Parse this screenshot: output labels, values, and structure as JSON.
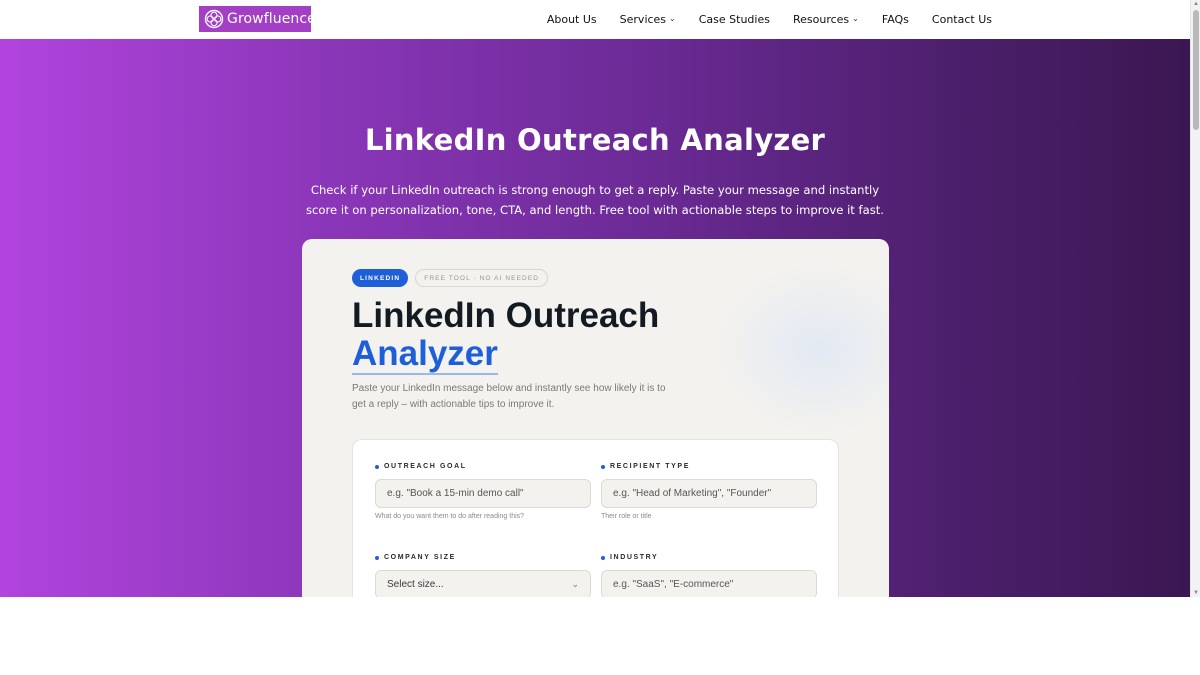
{
  "brand": {
    "name": "Growfluence",
    "logo_icon": "flower-icon",
    "color": "#a33fc4"
  },
  "nav": {
    "items": [
      {
        "label": "About Us",
        "dropdown": false
      },
      {
        "label": "Services",
        "dropdown": true
      },
      {
        "label": "Case Studies",
        "dropdown": false
      },
      {
        "label": "Resources",
        "dropdown": true
      },
      {
        "label": "FAQs",
        "dropdown": false
      },
      {
        "label": "Contact Us",
        "dropdown": false
      }
    ]
  },
  "hero": {
    "title": "LinkedIn Outreach Analyzer",
    "subtitle": "Check if your LinkedIn outreach is strong enough to get a reply. Paste your message and instantly score it on personalization, tone, CTA, and length. Free tool with actionable steps to improve it fast."
  },
  "card": {
    "badge_primary": "LINKEDIN",
    "badge_secondary": "FREE TOOL · NO AI NEEDED",
    "title_line1": "LinkedIn Outreach",
    "title_line2": "Analyzer",
    "description": "Paste your LinkedIn message below and instantly see how likely it is to get a reply – with actionable tips to improve it.",
    "accent_color": "#1e5fd8"
  },
  "form": {
    "outreach_goal": {
      "label": "OUTREACH GOAL",
      "placeholder": "e.g. \"Book a 15-min demo call\"",
      "hint": "What do you want them to do after reading this?"
    },
    "recipient_type": {
      "label": "RECIPIENT TYPE",
      "placeholder": "e.g. \"Head of Marketing\", \"Founder\"",
      "hint": "Their role or title"
    },
    "company_size": {
      "label": "COMPANY SIZE",
      "selected": "Select size..."
    },
    "industry": {
      "label": "INDUSTRY",
      "placeholder": "e.g. \"SaaS\", \"E-commerce\""
    }
  }
}
